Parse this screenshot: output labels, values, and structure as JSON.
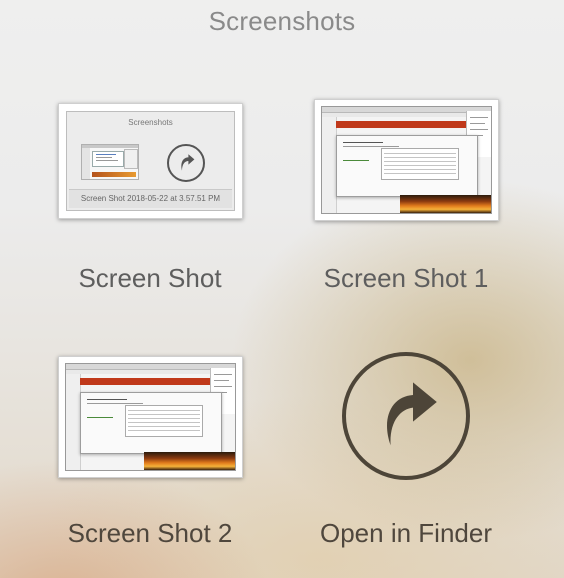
{
  "window": {
    "title": "Screenshots"
  },
  "items": [
    {
      "label": "Screen Shot",
      "thumbnail": {
        "dialog_title": "Screenshots",
        "caption": "Screen Shot 2018-05-22 at 3.57.51 PM"
      }
    },
    {
      "label": "Screen Shot 1"
    },
    {
      "label": "Screen Shot 2"
    },
    {
      "label": "Open in Finder",
      "icon": "share-arrow-icon"
    }
  ],
  "colors": {
    "title_text": "#8a8a8a",
    "label_text": "#5e5e5e",
    "finder_icon": "#4d4538"
  }
}
